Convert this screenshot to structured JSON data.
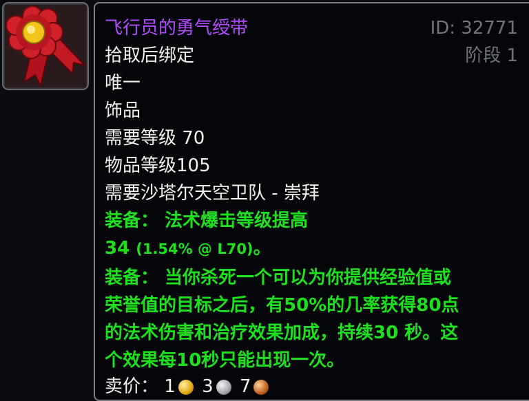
{
  "item": {
    "name": "飞行员的勇气绶带",
    "id_label": "ID: 32771",
    "stage_label": "阶段 1",
    "binding": "拾取后绑定",
    "uniqueness": "唯一",
    "slot": "饰品",
    "required_level": "需要等级 70",
    "item_level": "物品等级105",
    "reputation": "需要沙塔尔天空卫队 - 崇拜",
    "equip1_line1": "装备： 法术爆击等级提高",
    "equip1_value": "34",
    "equip1_detail": "(1.54% @ L70)",
    "equip1_end": "。",
    "equip2_line1": "装备： 当你杀死一个可以为你提供经验值或",
    "equip2_line2": "荣誉值的目标之后，有50%的几率获得80点",
    "equip2_line3": "的法术伤害和治疗效果加成，持续30 秒。这",
    "equip2_line4": "个效果每10秒只能出现一次。",
    "sell_label": "卖价：",
    "sell_gold": "1",
    "sell_silver": "3",
    "sell_copper": "7"
  },
  "colors": {
    "name": "#b14cff",
    "equip": "#1ee11e",
    "text": "#f2f2f2",
    "meta": "#6f757b"
  },
  "icon": "red-rosette-ribbon-icon"
}
